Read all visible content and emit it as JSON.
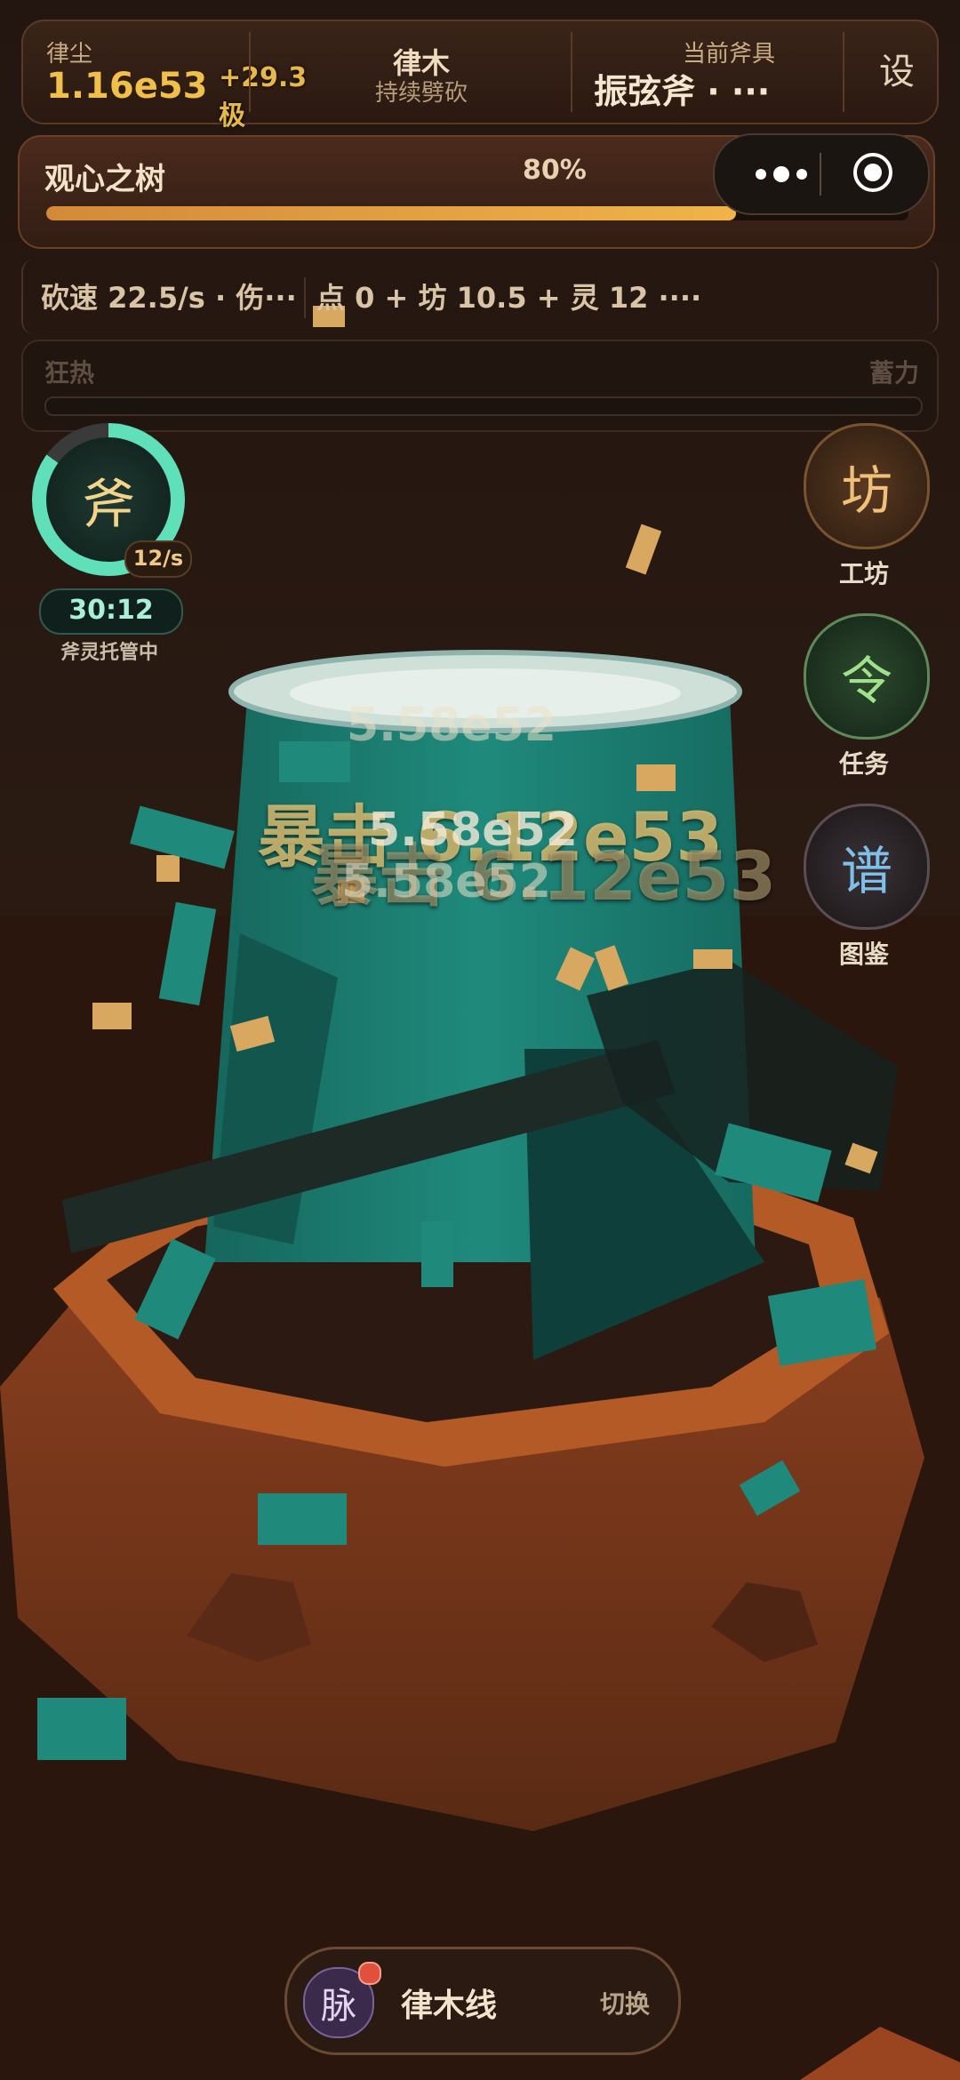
{
  "topbar": {
    "dust_label": "律尘",
    "dust_value": "1.16e53",
    "float_gain": "+29.3极",
    "wood_title": "律木",
    "wood_sub": "持续劈砍",
    "axe_label": "当前斧具",
    "axe_name": "振弦斧 · ···",
    "settings_label": "设"
  },
  "tree": {
    "name": "观心之树",
    "progress_text": "80%",
    "progress": 0.8
  },
  "miniapp": {
    "more_icon": "more-dots-icon",
    "close_icon": "target-circle-icon"
  },
  "stats": {
    "left": "砍速 22.5/s · 伤···",
    "right": "点 0 + 坊 10.5 + 灵 12 ····"
  },
  "frenzy": {
    "left_label": "狂热",
    "right_label": "蓄力"
  },
  "axe_spirit": {
    "glyph": "斧",
    "rate": "12/s",
    "timer": "30:12",
    "status": "斧灵托管中"
  },
  "side_buttons": [
    {
      "glyph": "坊",
      "label": "工坊"
    },
    {
      "glyph": "令",
      "label": "任务"
    },
    {
      "glyph": "谱",
      "label": "图鉴"
    }
  ],
  "damage": {
    "crit": "暴击 6.12e53",
    "hit_a": "5.58e52",
    "hit_b": "5.58e52",
    "hit_c": "5.58e52",
    "crit_b": "暴击 6.12e53"
  },
  "bottom": {
    "pulse_glyph": "脉",
    "line_name": "律木线",
    "switch_label": "切换"
  },
  "colors": {
    "accent_gold": "#f0c04a",
    "teal_tree": "#1f8a7c",
    "stump": "#7a3a1e"
  }
}
